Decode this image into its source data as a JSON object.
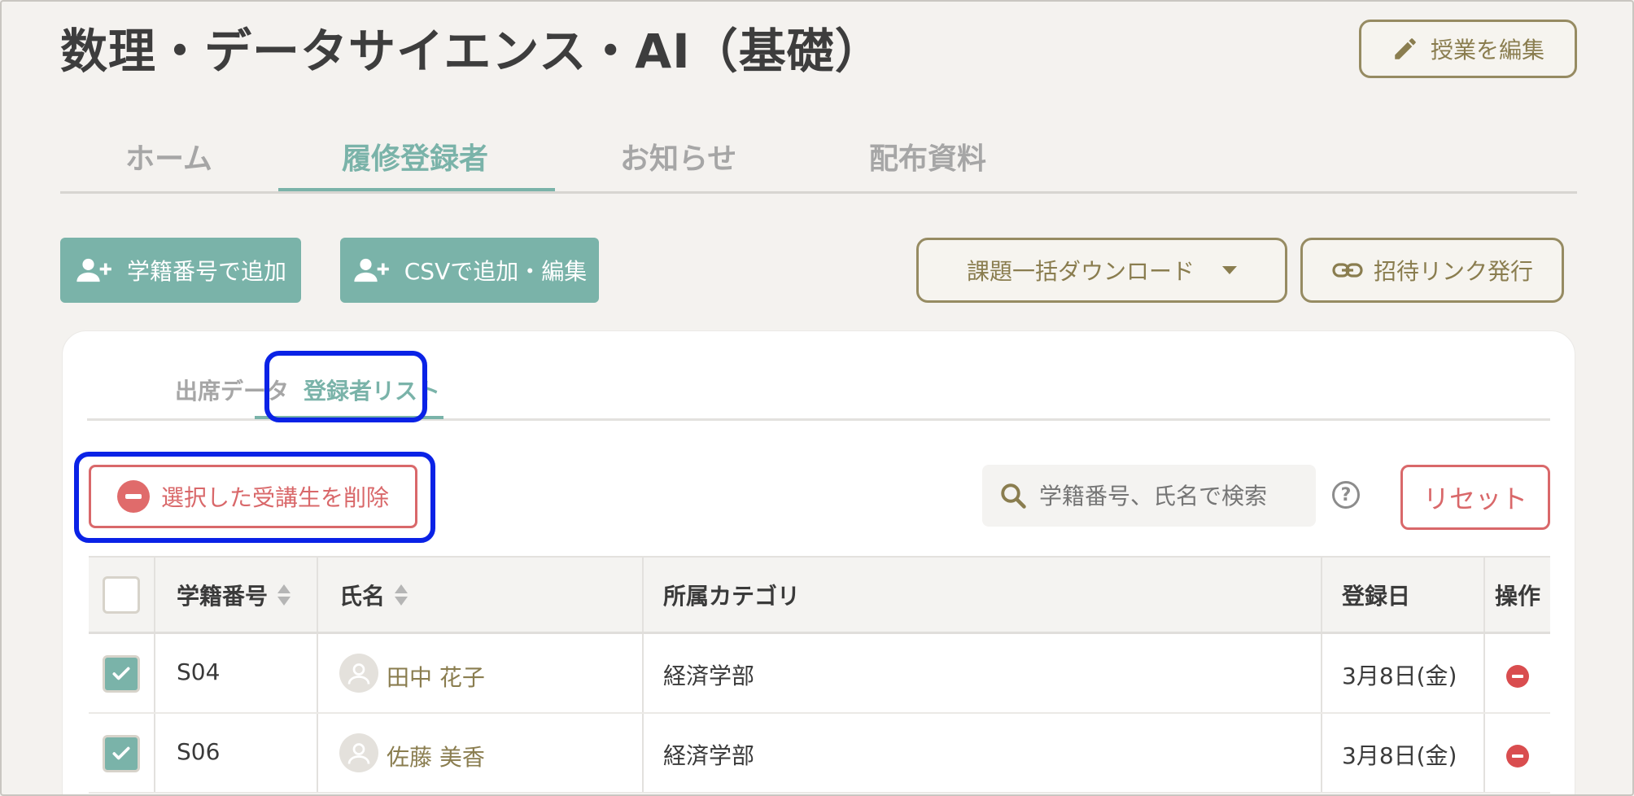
{
  "page": {
    "title": "数理・データサイエンス・AI（基礎）",
    "edit_label": "授業を編集"
  },
  "main_tabs": [
    {
      "label": "ホーム",
      "active": false
    },
    {
      "label": "履修登録者",
      "active": true
    },
    {
      "label": "お知らせ",
      "active": false
    },
    {
      "label": "配布資料",
      "active": false
    }
  ],
  "toolbar": {
    "add_by_id": "学籍番号で追加",
    "add_by_csv": "CSVで追加・編集",
    "bulk_download": "課題一括ダウンロード",
    "invite_link": "招待リンク発行"
  },
  "sub_tabs": [
    {
      "label": "出席データ",
      "active": false
    },
    {
      "label": "登録者リスト",
      "active": true
    }
  ],
  "actions": {
    "delete_selected": "選択した受講生を削除",
    "search_placeholder": "学籍番号、氏名で検索",
    "help": "?",
    "reset": "リセット"
  },
  "table": {
    "headers": [
      "学籍番号",
      "氏名",
      "所属カテゴリ",
      "登録日",
      "操作"
    ],
    "rows": [
      {
        "id": "S04",
        "name": "田中 花子",
        "category": "経済学部",
        "date": "3月8日(金)",
        "checked": true
      },
      {
        "id": "S06",
        "name": "佐藤 美香",
        "category": "経済学部",
        "date": "3月8日(金)",
        "checked": true
      }
    ]
  },
  "colors": {
    "teal": "#7ab3a9",
    "olive": "#8a7d4f",
    "danger": "#d9686a",
    "highlight": "#0a22e6",
    "background": "#f4f2ef"
  }
}
